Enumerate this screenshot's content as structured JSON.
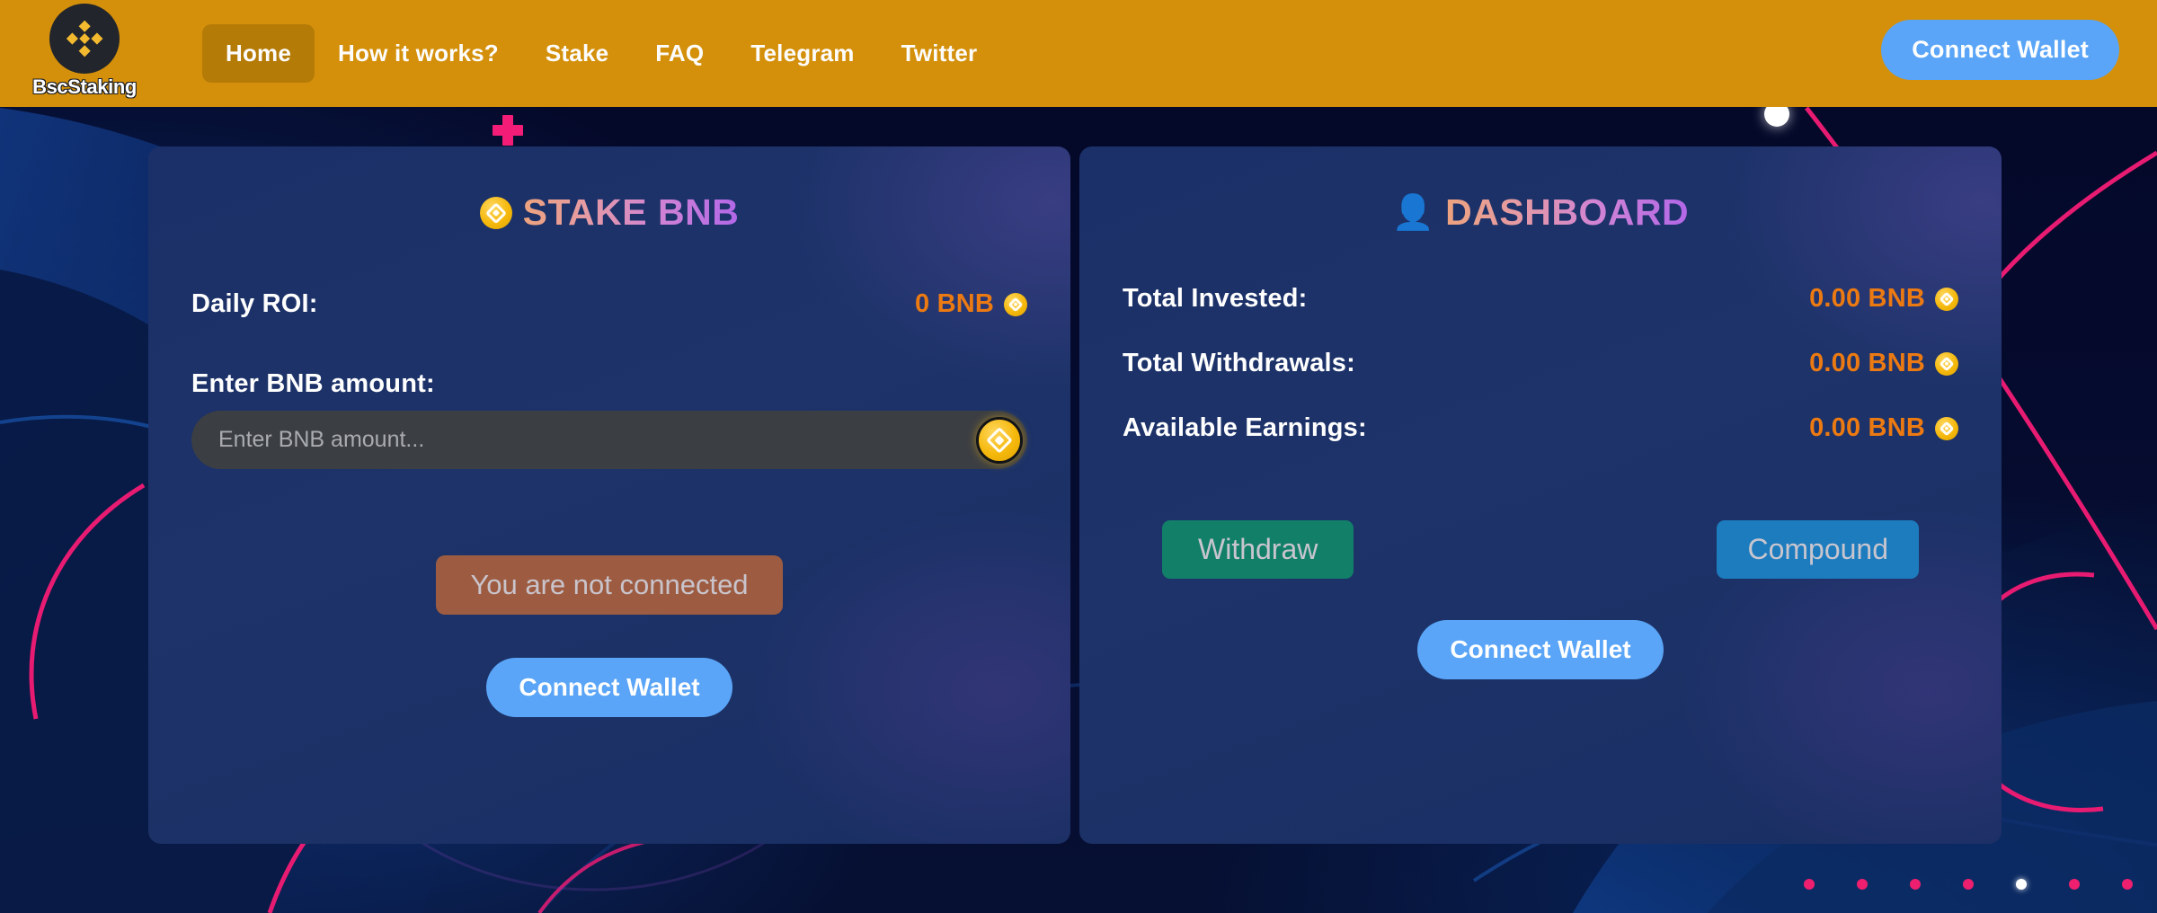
{
  "navbar": {
    "brand_name": "BscStaking",
    "brand_logo_icon": "binance-diamond-icon",
    "links": [
      {
        "label": "Home",
        "active": true
      },
      {
        "label": "How it works?",
        "active": false
      },
      {
        "label": "Stake",
        "active": false
      },
      {
        "label": "FAQ",
        "active": false
      },
      {
        "label": "Telegram",
        "active": false
      },
      {
        "label": "Twitter",
        "active": false
      }
    ],
    "connect_wallet_label": "Connect Wallet",
    "bg_color": "#d4900b",
    "active_bg_color": "#b57b07",
    "cta_color": "#5aa5f7"
  },
  "stake_card": {
    "icon": "bnb-coin-icon",
    "title": "STAKE BNB",
    "roi_label": "Daily ROI:",
    "roi_value": "0 BNB",
    "roi_coin_icon": "bnb-coin-icon",
    "amount_label": "Enter BNB amount:",
    "amount_placeholder": "Enter BNB amount...",
    "amount_value": "",
    "amount_coin_icon": "bnb-coin-icon",
    "status_label": "You are not connected",
    "connect_wallet_label": "Connect Wallet",
    "status_color": "#9d5c41"
  },
  "dashboard_card": {
    "icon": "person-verified-icon",
    "title": "DASHBOARD",
    "stats": [
      {
        "label": "Total Invested:",
        "value": "0.00 BNB",
        "coin_icon": "bnb-coin-icon"
      },
      {
        "label": "Total Withdrawals:",
        "value": "0.00 BNB",
        "coin_icon": "bnb-coin-icon"
      },
      {
        "label": "Available Earnings:",
        "value": "0.00 BNB",
        "coin_icon": "bnb-coin-icon"
      }
    ],
    "withdraw_label": "Withdraw",
    "compound_label": "Compound",
    "connect_wallet_label": "Connect Wallet",
    "withdraw_color": "#128069",
    "compound_color": "#1c7cbe"
  },
  "decor": {
    "plus_icon": "plus-mark-icon",
    "white_ball_icon": "white-dot-icon",
    "dots": [
      "pink",
      "pink",
      "pink",
      "pink",
      "white",
      "pink",
      "pink"
    ],
    "accent_pink": "#ee1f6e",
    "page_bg": "#050b2e",
    "card_bg": "#1d3369",
    "value_orange": "#ec7a12"
  }
}
